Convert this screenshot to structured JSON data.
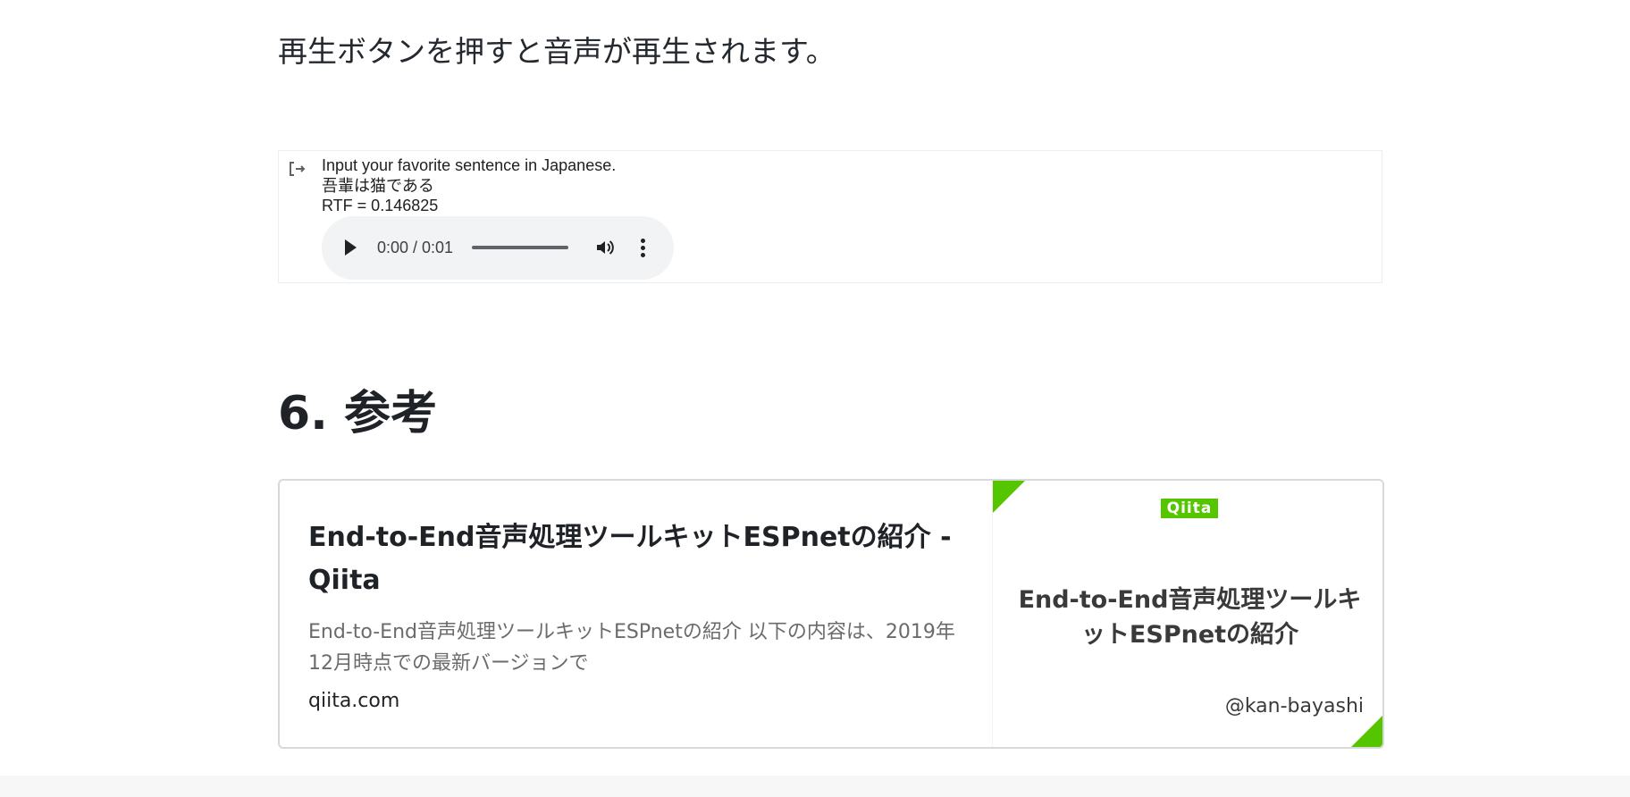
{
  "intro_text": "再生ボタンを押すと音声が再生されます。",
  "output": {
    "icon": "output-redirect-icon",
    "lines": [
      "Input your favorite sentence in Japanese.",
      "吾輩は猫である",
      "RTF = 0.146825"
    ],
    "player": {
      "time": "0:00 / 0:01",
      "progress": 0.0
    }
  },
  "section": {
    "heading": "6. 参考"
  },
  "link_card": {
    "title": "End-to-End音声処理ツールキットESPnetの紹介 - Qiita",
    "description": "End-to-End音声処理ツールキットESPnetの紹介 以下の内容は、2019年12月時点での最新バージョンで",
    "domain": "qiita.com",
    "thumbnail": {
      "logo": "Qiita",
      "title": "End-to-End音声処理ツールキットESPnetの紹介",
      "author": "@kan-bayashi",
      "accent": "#55c500"
    }
  }
}
